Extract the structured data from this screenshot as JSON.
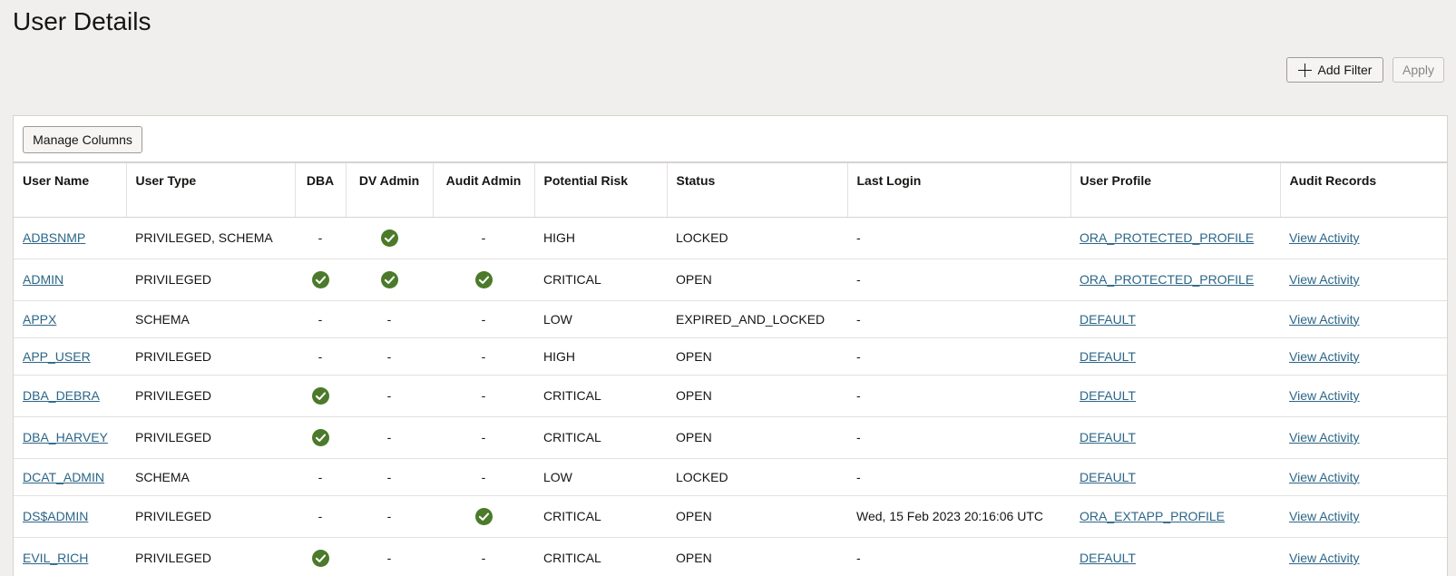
{
  "page": {
    "title": "User Details"
  },
  "toolbar": {
    "add_filter_label": "Add Filter",
    "apply_label": "Apply",
    "manage_columns_label": "Manage Columns"
  },
  "colors": {
    "check_green": "#4b7a2a",
    "link_blue": "#2b6687"
  },
  "table": {
    "headers": {
      "user_name": "User Name",
      "user_type": "User Type",
      "dba": "DBA",
      "dv_admin": "DV Admin",
      "audit_admin": "Audit Admin",
      "potential_risk": "Potential Risk",
      "status": "Status",
      "last_login": "Last Login",
      "user_profile": "User Profile",
      "audit_records": "Audit Records"
    },
    "rows": [
      {
        "user_name": "ADBSNMP",
        "user_type": "PRIVILEGED, SCHEMA",
        "dba": false,
        "dv_admin": true,
        "audit_admin": false,
        "potential_risk": "HIGH",
        "status": "LOCKED",
        "last_login": "-",
        "user_profile": "ORA_PROTECTED_PROFILE",
        "audit_records": "View Activity",
        "tall": true
      },
      {
        "user_name": "ADMIN",
        "user_type": "PRIVILEGED",
        "dba": true,
        "dv_admin": true,
        "audit_admin": true,
        "potential_risk": "CRITICAL",
        "status": "OPEN",
        "last_login": "-",
        "user_profile": "ORA_PROTECTED_PROFILE",
        "audit_records": "View Activity",
        "tall": true
      },
      {
        "user_name": "APPX",
        "user_type": "SCHEMA",
        "dba": false,
        "dv_admin": false,
        "audit_admin": false,
        "potential_risk": "LOW",
        "status": "EXPIRED_AND_LOCKED",
        "last_login": "-",
        "user_profile": "DEFAULT",
        "audit_records": "View Activity",
        "tall": false
      },
      {
        "user_name": "APP_USER",
        "user_type": "PRIVILEGED",
        "dba": false,
        "dv_admin": false,
        "audit_admin": false,
        "potential_risk": "HIGH",
        "status": "OPEN",
        "last_login": "-",
        "user_profile": "DEFAULT",
        "audit_records": "View Activity",
        "tall": false
      },
      {
        "user_name": "DBA_DEBRA",
        "user_type": "PRIVILEGED",
        "dba": true,
        "dv_admin": false,
        "audit_admin": false,
        "potential_risk": "CRITICAL",
        "status": "OPEN",
        "last_login": "-",
        "user_profile": "DEFAULT",
        "audit_records": "View Activity",
        "tall": true
      },
      {
        "user_name": "DBA_HARVEY",
        "user_type": "PRIVILEGED",
        "dba": true,
        "dv_admin": false,
        "audit_admin": false,
        "potential_risk": "CRITICAL",
        "status": "OPEN",
        "last_login": "-",
        "user_profile": "DEFAULT",
        "audit_records": "View Activity",
        "tall": true
      },
      {
        "user_name": "DCAT_ADMIN",
        "user_type": "SCHEMA",
        "dba": false,
        "dv_admin": false,
        "audit_admin": false,
        "potential_risk": "LOW",
        "status": "LOCKED",
        "last_login": "-",
        "user_profile": "DEFAULT",
        "audit_records": "View Activity",
        "tall": false
      },
      {
        "user_name": "DS$ADMIN",
        "user_type": "PRIVILEGED",
        "dba": false,
        "dv_admin": false,
        "audit_admin": true,
        "potential_risk": "CRITICAL",
        "status": "OPEN",
        "last_login": "Wed, 15 Feb 2023 20:16:06 UTC",
        "user_profile": "ORA_EXTAPP_PROFILE",
        "audit_records": "View Activity",
        "tall": true
      },
      {
        "user_name": "EVIL_RICH",
        "user_type": "PRIVILEGED",
        "dba": true,
        "dv_admin": false,
        "audit_admin": false,
        "potential_risk": "CRITICAL",
        "status": "OPEN",
        "last_login": "-",
        "user_profile": "DEFAULT",
        "audit_records": "View Activity",
        "tall": true
      }
    ],
    "empty_flag_text": "-",
    "check_icon_name": "check-circle-icon"
  }
}
